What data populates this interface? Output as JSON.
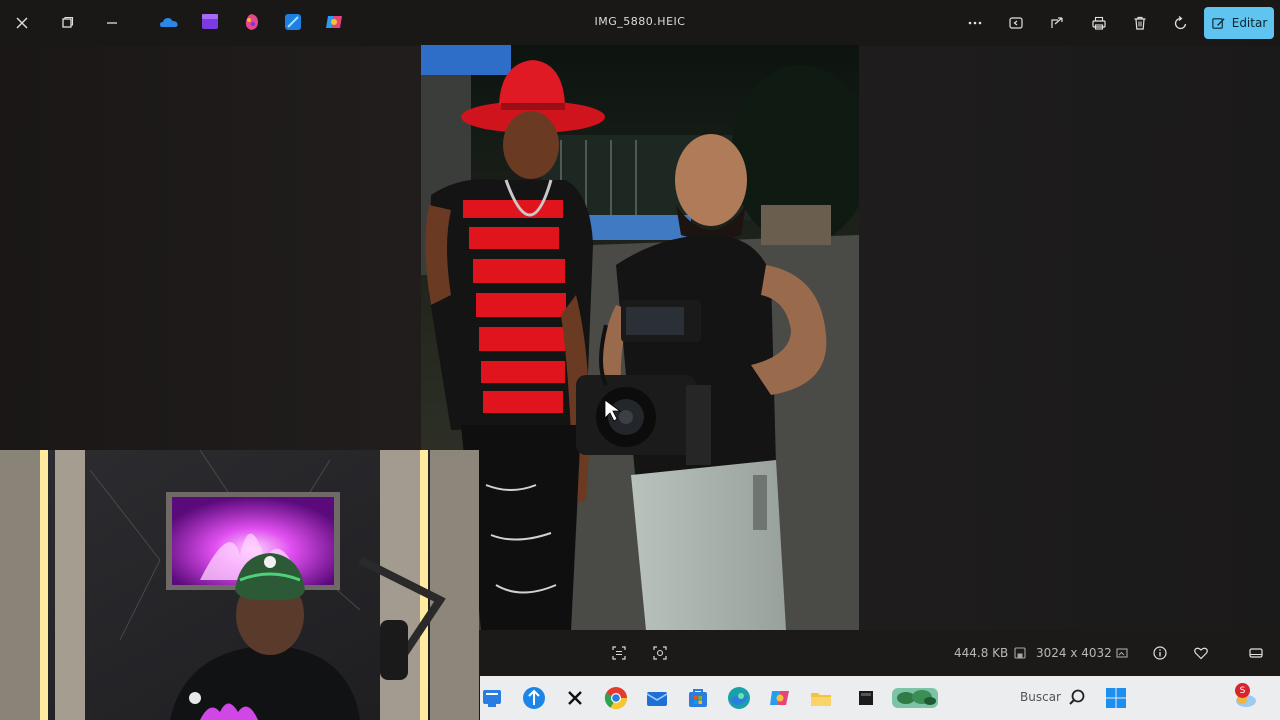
{
  "titlebar": {
    "file_name": "IMG_5880.HEIC",
    "edit_label": "Editar",
    "icons": [
      "close-icon",
      "restore-icon",
      "minimize-icon",
      "onedrive-icon",
      "clipchamp-icon",
      "paint-icon",
      "designer-icon",
      "copilot-icon",
      "more-icon",
      "slideshow-icon",
      "share-icon",
      "print-icon",
      "delete-icon",
      "rotate-icon",
      "edit-icon"
    ]
  },
  "infobar": {
    "file_size": "444.8 KB",
    "dimensions": "3024 x 4032",
    "icons": [
      "scan-icon",
      "crop-icon",
      "save-icon",
      "image-info-icon",
      "info-icon",
      "favorite-icon",
      "filmstrip-icon"
    ]
  },
  "taskbar": {
    "search_placeholder": "Buscar",
    "notification_badge": "S",
    "icons": [
      "edge-icon",
      "taskbar-blue-icon",
      "x-app-icon",
      "chrome-icon",
      "mail-icon",
      "store-icon",
      "browser-icon",
      "copilot-icon",
      "explorer-icon",
      "terminal-icon",
      "weather-widget",
      "search-icon",
      "windows-start-icon",
      "notification-icon"
    ]
  },
  "colors": {
    "accent": "#5fc5f0",
    "background": "#1c1a19",
    "taskbar": "#ecedef"
  }
}
